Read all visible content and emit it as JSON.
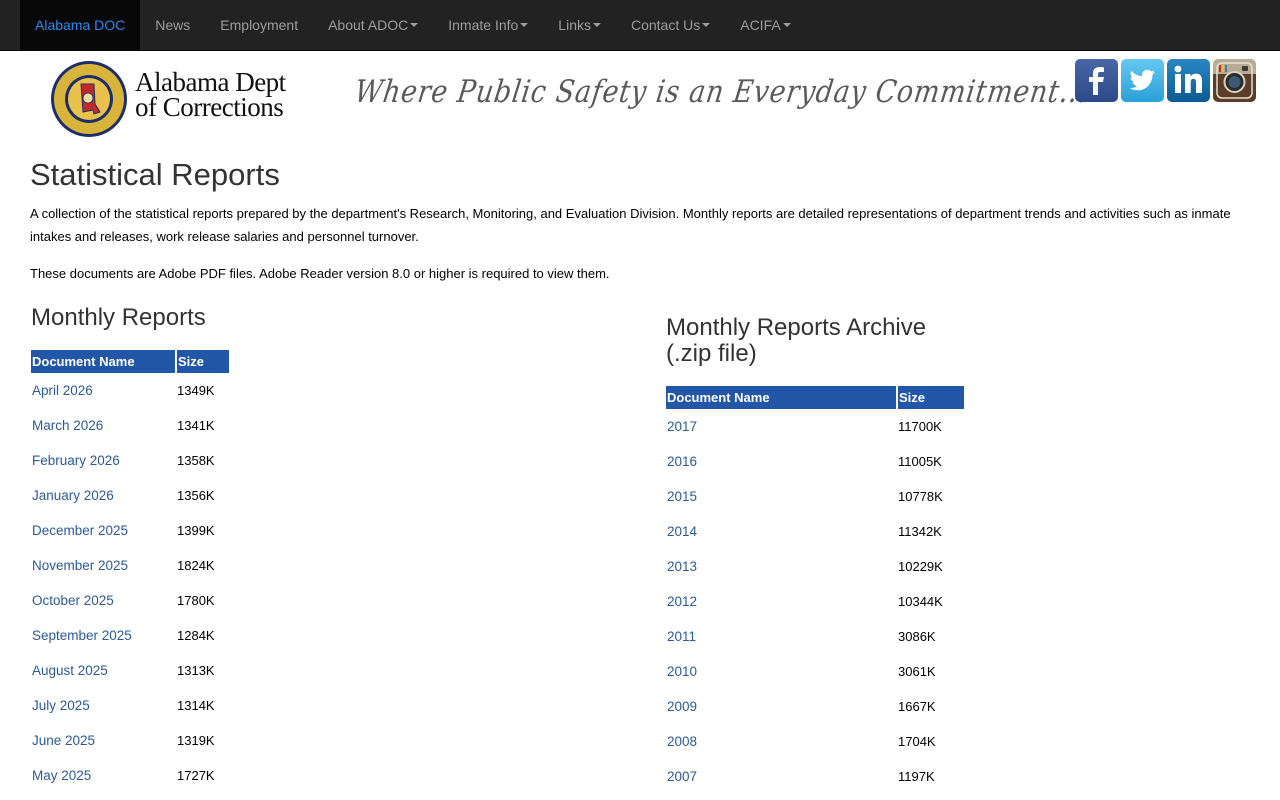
{
  "nav": {
    "brand": "Alabama DOC",
    "items": [
      {
        "label": "News",
        "dropdown": false
      },
      {
        "label": "Employment",
        "dropdown": false
      },
      {
        "label": "About ADOC",
        "dropdown": true
      },
      {
        "label": "Inmate Info",
        "dropdown": true
      },
      {
        "label": "Links",
        "dropdown": true
      },
      {
        "label": "Contact Us",
        "dropdown": true
      },
      {
        "label": "ACIFA",
        "dropdown": true
      }
    ]
  },
  "header": {
    "logo_line1": "Alabama Dept",
    "logo_line2": "of Corrections",
    "seal_top_text": "DEPARTMENT OF",
    "seal_bottom_text": "CORRECTIONS",
    "tagline": "Where Public Safety is an Everyday Commitment...",
    "social": [
      "facebook-icon",
      "twitter-icon",
      "linkedin-icon",
      "instagram-icon"
    ]
  },
  "page": {
    "title": "Statistical Reports",
    "intro": "A collection of the statistical reports prepared by the department's Research, Monitoring, and Evaluation Division. Monthly reports are detailed representations of department trends and activities such as inmate intakes and releases, work release salaries and personnel turnover.",
    "note": "These documents are Adobe PDF files. Adobe Reader version 8.0 or higher is required to view them."
  },
  "monthly": {
    "title": "Monthly Reports",
    "col_name": "Document Name",
    "col_size": "Size",
    "rows": [
      {
        "name": "April 2026",
        "size": "1349K"
      },
      {
        "name": "March 2026",
        "size": "1341K"
      },
      {
        "name": "February 2026",
        "size": "1358K"
      },
      {
        "name": "January 2026",
        "size": "1356K"
      },
      {
        "name": "December 2025",
        "size": "1399K"
      },
      {
        "name": "November 2025",
        "size": "1824K"
      },
      {
        "name": "October 2025",
        "size": "1780K"
      },
      {
        "name": "September 2025",
        "size": "1284K"
      },
      {
        "name": "August 2025",
        "size": "1313K"
      },
      {
        "name": "July 2025",
        "size": "1314K"
      },
      {
        "name": "June 2025",
        "size": "1319K"
      },
      {
        "name": "May 2025",
        "size": "1727K"
      }
    ]
  },
  "archive": {
    "title_line1": "Monthly Reports Archive",
    "title_line2": "(.zip file)",
    "col_name": "Document Name",
    "col_size": "Size",
    "rows": [
      {
        "name": "2017",
        "size": "11700K"
      },
      {
        "name": "2016",
        "size": "11005K"
      },
      {
        "name": "2015",
        "size": "10778K"
      },
      {
        "name": "2014",
        "size": "11342K"
      },
      {
        "name": "2013",
        "size": "10229K"
      },
      {
        "name": "2012",
        "size": "10344K"
      },
      {
        "name": "2011",
        "size": "3086K"
      },
      {
        "name": "2010",
        "size": "3061K"
      },
      {
        "name": "2009",
        "size": "1667K"
      },
      {
        "name": "2008",
        "size": "1704K"
      },
      {
        "name": "2007",
        "size": "1197K"
      }
    ]
  }
}
